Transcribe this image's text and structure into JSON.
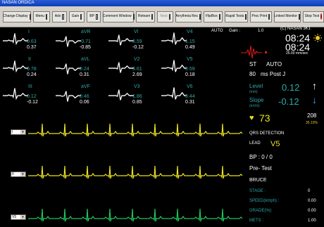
{
  "window": {
    "title": "NASAN ORDICA"
  },
  "toolbar": {
    "buttons": [
      {
        "label": "Change Display",
        "icon": "display-icon"
      },
      {
        "label": "Menu",
        "icon": "menu-icon"
      },
      {
        "label": "Adv",
        "icon": "arrow-right-icon"
      },
      {
        "label": "Gain",
        "icon": "gain-icon"
      },
      {
        "label": "BP",
        "icon": "bp-icon"
      },
      {
        "label": "Comment Window",
        "icon": "comment-icon"
      },
      {
        "label": "Relearn",
        "icon": "relearn-icon"
      },
      {
        "label": "Next",
        "icon": "next-icon",
        "disabled": true
      },
      {
        "label": "Arrythmia Rec",
        "icon": "arrhythmia-icon"
      },
      {
        "label": "FlipBox",
        "icon": "flipbox-icon"
      },
      {
        "label": "Rapid Tests",
        "icon": "rapid-icon"
      },
      {
        "label": "Proc Print",
        "icon": "print-icon"
      },
      {
        "label": "Linked Monitor",
        "icon": "link-icon"
      },
      {
        "label": "Stop Test",
        "icon": "stop-icon"
      }
    ]
  },
  "status": {
    "mode": "AUTO",
    "gain_label": "Gain :",
    "gain_value": "1.0"
  },
  "leads": [
    {
      "name": "I",
      "v1": "0.63",
      "v2": "0.37"
    },
    {
      "name": "aVR",
      "v1": "-0.71",
      "v2": "-0.85"
    },
    {
      "name": "VI",
      "v1": "0.59",
      "v2": "-0.12"
    },
    {
      "name": "V4",
      "v1": "1.15",
      "v2": "0.49"
    },
    {
      "name": "II",
      "v1": "0.78",
      "v2": "0.24"
    },
    {
      "name": "aVL",
      "v1": "0.24",
      "v2": "0.31"
    },
    {
      "name": "V2",
      "v1": "3.61",
      "v2": "2.69"
    },
    {
      "name": "V5",
      "v1": "0.59",
      "v2": "0.18"
    },
    {
      "name": "III",
      "v1": "0.12",
      "v2": "-0.12"
    },
    {
      "name": "aVF",
      "v1": "0.46",
      "v2": "0.06"
    },
    {
      "name": "V3",
      "v1": "1.86",
      "v2": "0.85"
    },
    {
      "name": "V6",
      "v1": "0.44",
      "v2": "0.31"
    }
  ],
  "right": {
    "brand": "(C) NASAN 3K1",
    "time1": "08:24",
    "time2": "08:24",
    "speed": "25.00 mm/sec",
    "st_label": "ST",
    "st_mode": "AUTO",
    "post_j_value": "80",
    "post_j_label": "ms Post J",
    "level_label": "Level",
    "level_unit": "(mm)",
    "level_value": "0.12",
    "slope_label": "Slope",
    "slope_unit": "(mV/s)",
    "slope_value": "-0.12",
    "heart_rate": "73",
    "target_hr": "208",
    "target_pct": "35.10%",
    "qrs_label": "QRS DETECTION",
    "lead_label": "LEAD",
    "lead_value": "V5",
    "bp": "BP : 0 / 0",
    "phase": "Pre- Test",
    "protocol": "BRUCE",
    "stage_label": "STAGE :",
    "stage_value": "0",
    "speed_label": "SPEED(kmph) :",
    "speed_value": "0.00",
    "grade_label": "GRADE(%):",
    "grade_value": "0.00",
    "mets_label": "METS :",
    "mets_value": "1.00"
  },
  "strips": [
    {
      "lead": "I",
      "color": "#e8e020"
    },
    {
      "lead": "II",
      "color": "#e8e020"
    },
    {
      "lead": "V5",
      "color": "#1fc45a"
    }
  ],
  "colors": {
    "teal": "#2fa8a8",
    "yellow": "#e8e020",
    "green": "#1fc45a",
    "red": "#e21b1b",
    "slope_blue": "#3aa0ff"
  }
}
